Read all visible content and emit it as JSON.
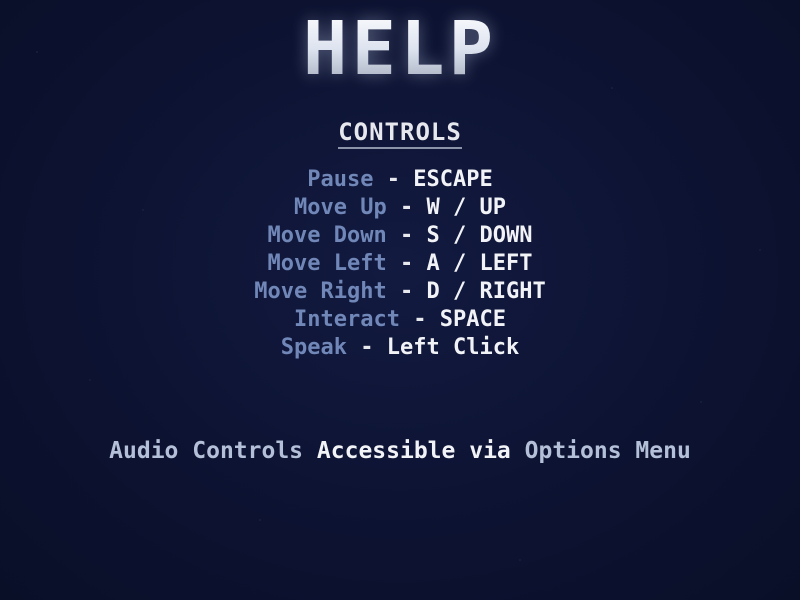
{
  "screen": {
    "title": "HELP",
    "background_color": "#0d1230"
  },
  "controls": {
    "heading": "CONTROLS",
    "items": [
      {
        "action": "Pause",
        "separator": "-",
        "keys": "ESCAPE"
      },
      {
        "action": "Move Up",
        "separator": "-",
        "keys": "W / UP"
      },
      {
        "action": "Move Down",
        "separator": "-",
        "keys": "S / DOWN"
      },
      {
        "action": "Move Left",
        "separator": "-",
        "keys": "A / LEFT"
      },
      {
        "action": "Move Right",
        "separator": "-",
        "keys": "D / RIGHT"
      },
      {
        "action": "Interact",
        "separator": "-",
        "keys": "SPACE"
      },
      {
        "action": "Speak",
        "separator": "-",
        "keys": "Left Click"
      }
    ],
    "action_color": "#7087b8",
    "key_color": "#f2f3f7"
  },
  "footer": {
    "part1": "Audio Controls",
    "part2": "Accessible via",
    "part3": "Options Menu"
  }
}
